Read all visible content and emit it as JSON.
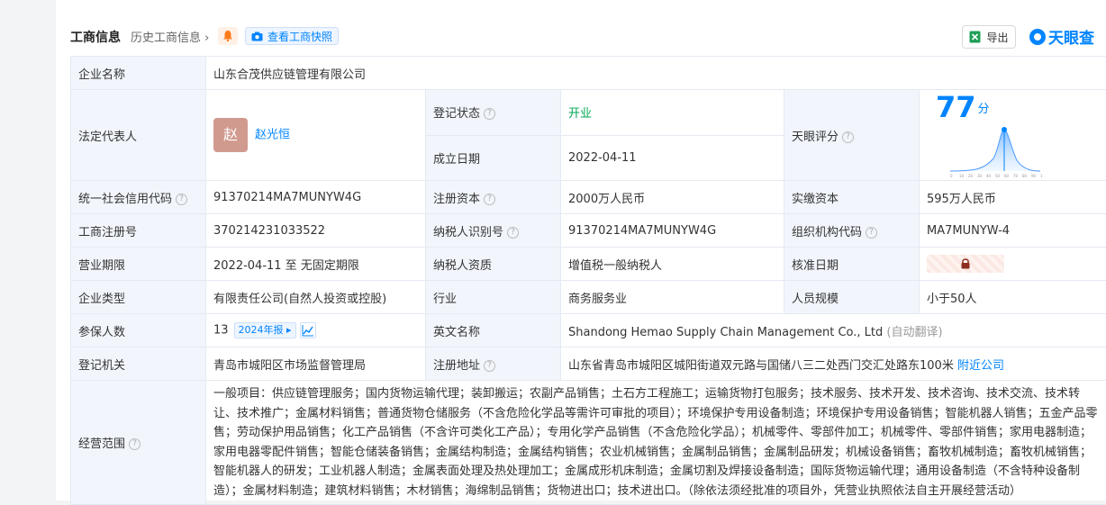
{
  "header": {
    "title": "工商信息",
    "history": "历史工商信息",
    "snapshot_label": "查看工商快照",
    "export_label": "导出",
    "logo_text": "天眼查"
  },
  "company_name_label": "企业名称",
  "company_name": "山东合茂供应链管理有限公司",
  "legal_rep_label": "法定代表人",
  "legal_rep_avatar": "赵",
  "legal_rep": "赵光恒",
  "reg_status_label": "登记状态",
  "reg_status": "开业",
  "found_date_label": "成立日期",
  "found_date": "2022-04-11",
  "score_label": "天眼评分",
  "score_value": "77",
  "score_unit": "分",
  "score_axis": [
    "0",
    "10",
    "20",
    "30",
    "40",
    "50",
    "60",
    "70",
    "80",
    "90",
    "100"
  ],
  "credit_code_label": "统一社会信用代码",
  "credit_code": "91370214MA7MUNYW4G",
  "reg_capital_label": "注册资本",
  "reg_capital": "2000万人民币",
  "paid_capital_label": "实缴资本",
  "paid_capital": "595万人民币",
  "biz_reg_no_label": "工商注册号",
  "biz_reg_no": "370214231033522",
  "taxpayer_id_label": "纳税人识别号",
  "taxpayer_id": "91370214MA7MUNYW4G",
  "org_code_label": "组织机构代码",
  "org_code": "MA7MUNYW-4",
  "biz_term_label": "营业期限",
  "biz_term": "2022-04-11 至 无固定期限",
  "taxpayer_qual_label": "纳税人资质",
  "taxpayer_qual": "增值税一般纳税人",
  "approval_date_label": "核准日期",
  "company_type_label": "企业类型",
  "company_type": "有限责任公司(自然人投资或控股)",
  "industry_label": "行业",
  "industry": "商务服务业",
  "staff_size_label": "人员规模",
  "staff_size": "小于50人",
  "insured_label": "参保人数",
  "insured": "13",
  "insured_report": "2024年报",
  "english_name_label": "英文名称",
  "english_name": "Shandong Hemao Supply Chain Management Co., Ltd",
  "auto_translate": "(自动翻译)",
  "reg_authority_label": "登记机关",
  "reg_authority": "青岛市城阳区市场监督管理局",
  "reg_address_label": "注册地址",
  "reg_address": "山东省青岛市城阳区城阳街道双元路与国储八三二处西门交汇处路东100米",
  "nearby": "附近公司",
  "scope_label": "经营范围",
  "scope": "一般项目：供应链管理服务；国内货物运输代理；装卸搬运；农副产品销售；土石方工程施工；运输货物打包服务；技术服务、技术开发、技术咨询、技术交流、技术转让、技术推广；金属材料销售；普通货物仓储服务（不含危险化学品等需许可审批的项目）；环境保护专用设备制造；环境保护专用设备销售；智能机器人销售；五金产品零售；劳动保护用品销售；化工产品销售（不含许可类化工产品）；专用化学产品销售（不含危险化学品）；机械零件、零部件加工；机械零件、零部件销售；家用电器制造；家用电器零配件销售；智能仓储装备销售；金属结构制造；金属结构销售；农业机械销售；金属制品销售；金属制品研发；机械设备销售；畜牧机械制造；畜牧机械销售；智能机器人的研发；工业机器人制造；金属表面处理及热处理加工；金属成形机床制造；金属切割及焊接设备制造；国际货物运输代理；通用设备制造（不含特种设备制造）；金属材料制造；建筑材料销售；木材销售；海绵制品销售；货物进出口；技术进出口。（除依法须经批准的项目外，凭营业执照依法自主开展经营活动）",
  "colors": {
    "accent": "#0084ff",
    "label_bg": "#f2f6fc",
    "status_green": "#00a854"
  }
}
